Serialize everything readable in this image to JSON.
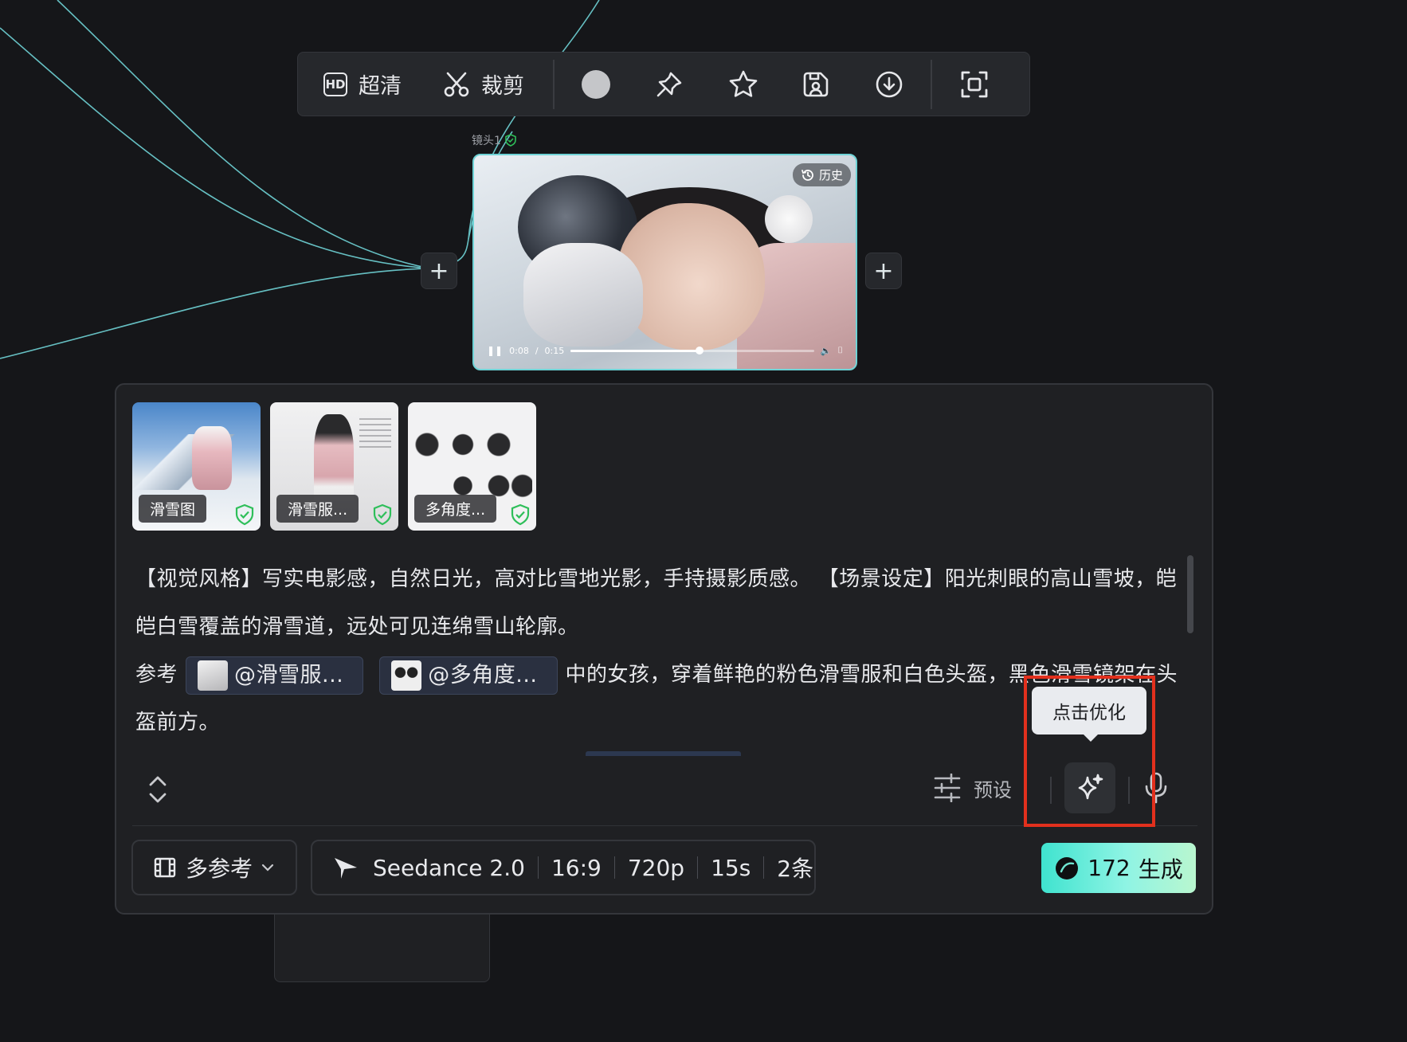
{
  "toolbar": {
    "hd_label": "超清",
    "hd_badge": "HD",
    "crop_label": "裁剪"
  },
  "shot": {
    "label": "镜头1",
    "history_label": "历史",
    "time_current": "0:08",
    "time_total": "0:15",
    "progress": 0.53
  },
  "references": [
    {
      "caption": "滑雪图"
    },
    {
      "caption": "滑雪服..."
    },
    {
      "caption": "多角度..."
    }
  ],
  "prompt": {
    "line1": "【视觉风格】写实电影感，自然日光，高对比雪地光影，手持摄影质感。 【场景设定】阳光刺眼的高山雪坡，皑皑白雪覆盖的滑雪道，远处可见连绵雪山轮廓。",
    "ref_prefix": "参考",
    "chip1": "@滑雪服...",
    "chip2": "@多角度...",
    "ref_suffix": "中的女孩，穿着鲜艳的粉色滑雪服和白色头盔，黑色滑雪镜架在头盔前方。"
  },
  "tools": {
    "preset_label": "预设",
    "tooltip": "点击优化"
  },
  "settings": {
    "mode_label": "多参考",
    "model": "Seedance 2.0",
    "ratio": "16:9",
    "resolution": "720p",
    "duration": "15s",
    "count": "2条"
  },
  "generate": {
    "cost": "172",
    "label": "生成"
  },
  "colors": {
    "accent": "#6fd3d6",
    "highlight": "#e2301d",
    "generate_start": "#3fe3cf",
    "generate_end": "#b9f6cf",
    "shield": "#2fbf5a"
  }
}
